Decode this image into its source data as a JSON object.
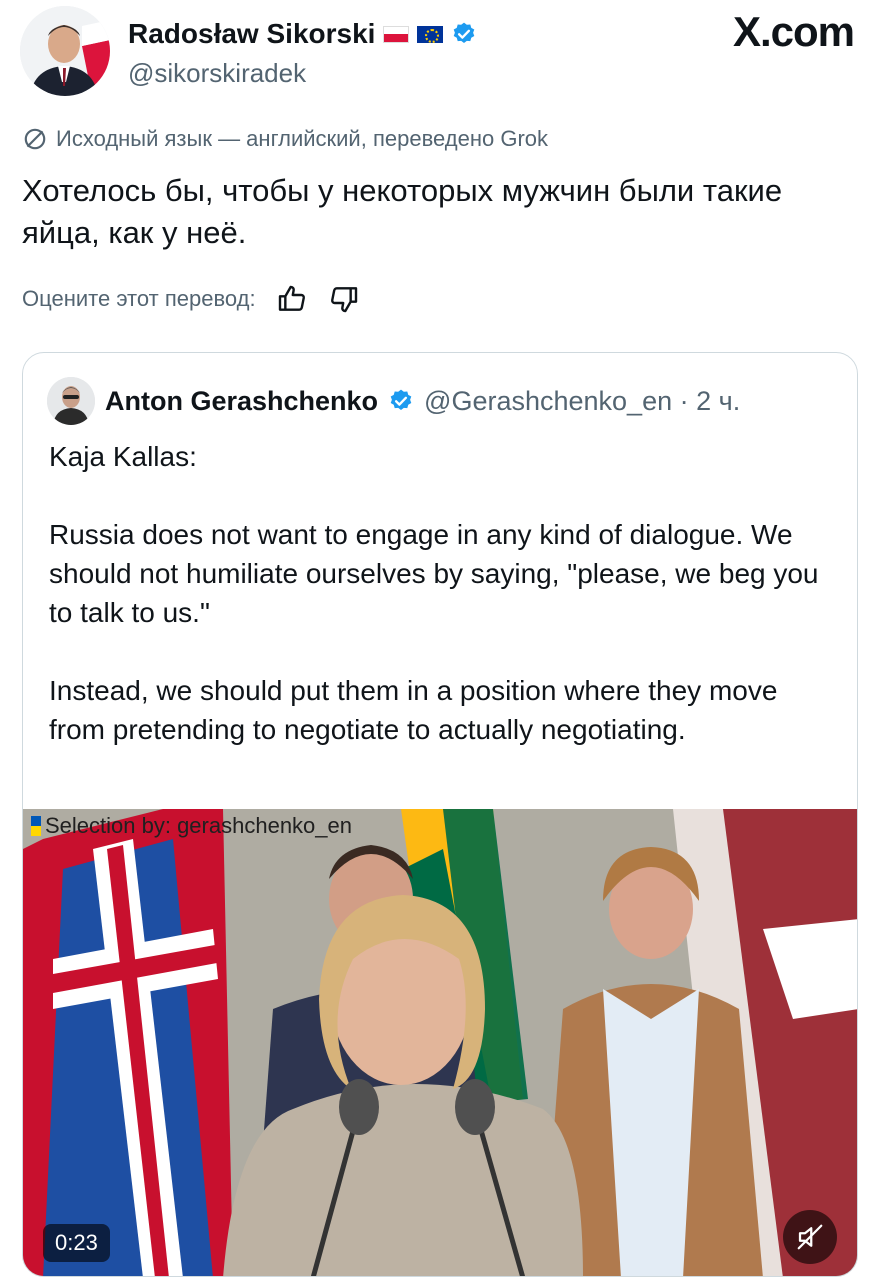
{
  "author": {
    "display_name": "Radosław Sikorski",
    "handle": "@sikorskiradek"
  },
  "site_logo": "X.com",
  "translation": {
    "notice": "Исходный язык — английский, переведено Grok",
    "text": "Хотелось бы, чтобы у некоторых мужчин были такие яйца, как у неё.",
    "rate_label": "Оцените этот перевод:"
  },
  "quoted_post": {
    "display_name": "Anton Gerashchenko",
    "handle_time": "@Gerashchenko_en · 2 ч.",
    "text": "Kaja Kallas:\n\nRussia does not want to engage in any kind of dialogue. We should not humiliate ourselves by saying, \"please, we beg you to talk to us.\"\n\nInstead, we should put them in a position where they move from pretending to negotiate to actually negotiating.",
    "video": {
      "overlay": "Selection by: gerashchenko_en",
      "duration": "0:23"
    }
  },
  "icons": {
    "verified": "verified-badge-icon",
    "translate": "slash-circle-icon",
    "thumbs_up": "thumbs-up-icon",
    "thumbs_down": "thumbs-down-icon",
    "mute": "muted-speaker-icon"
  },
  "colors": {
    "verified_blue": "#1d9bf0",
    "secondary_text": "#536471",
    "border": "#cfd9de"
  }
}
